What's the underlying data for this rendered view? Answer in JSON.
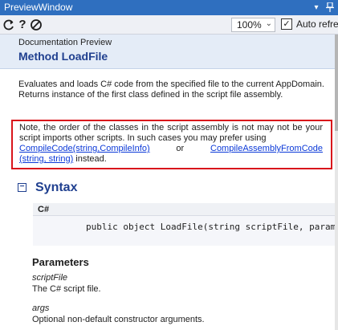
{
  "window": {
    "title": "PreviewWindow"
  },
  "titlebar": {
    "dropdown_icon": "▾",
    "pin_icon": "📌"
  },
  "toolbar": {
    "help_glyph": "?",
    "zoom_value": "100%",
    "autorefresh_label": "Auto refresh",
    "autorefresh_checked": "✓"
  },
  "header": {
    "subtitle": "Documentation Preview",
    "title": "Method LoadFile"
  },
  "description": "Evaluates and loads C# code from the specified file to the current AppDomain. Returns instance of the first class defined in the script file assembly.",
  "note": {
    "text_before": "Note, the order of the classes in the script assembly is not may not be your script imports other scripts. In such cases you may prefer using",
    "link1": "CompileCode(string,CompileInfo)",
    "middle": "or",
    "link2": "CompileAssemblyFromCode",
    "link2_cont": "(string, string)",
    "text_after": " instead."
  },
  "syntax": {
    "title": "Syntax",
    "collapse_glyph": "−",
    "language": "C#",
    "code": "public object LoadFile(string scriptFile, params object[] args)"
  },
  "parameters": {
    "title": "Parameters",
    "items": [
      {
        "name": "scriptFile",
        "desc": "The C# script file."
      },
      {
        "name": "args",
        "desc": "Optional non-default constructor arguments."
      }
    ]
  },
  "colors": {
    "titlebar": "#2f6fbf",
    "header_bg": "#e4ecf7",
    "heading": "#1f3f8f",
    "note_border": "#d9151b",
    "link": "#0b39d8"
  }
}
